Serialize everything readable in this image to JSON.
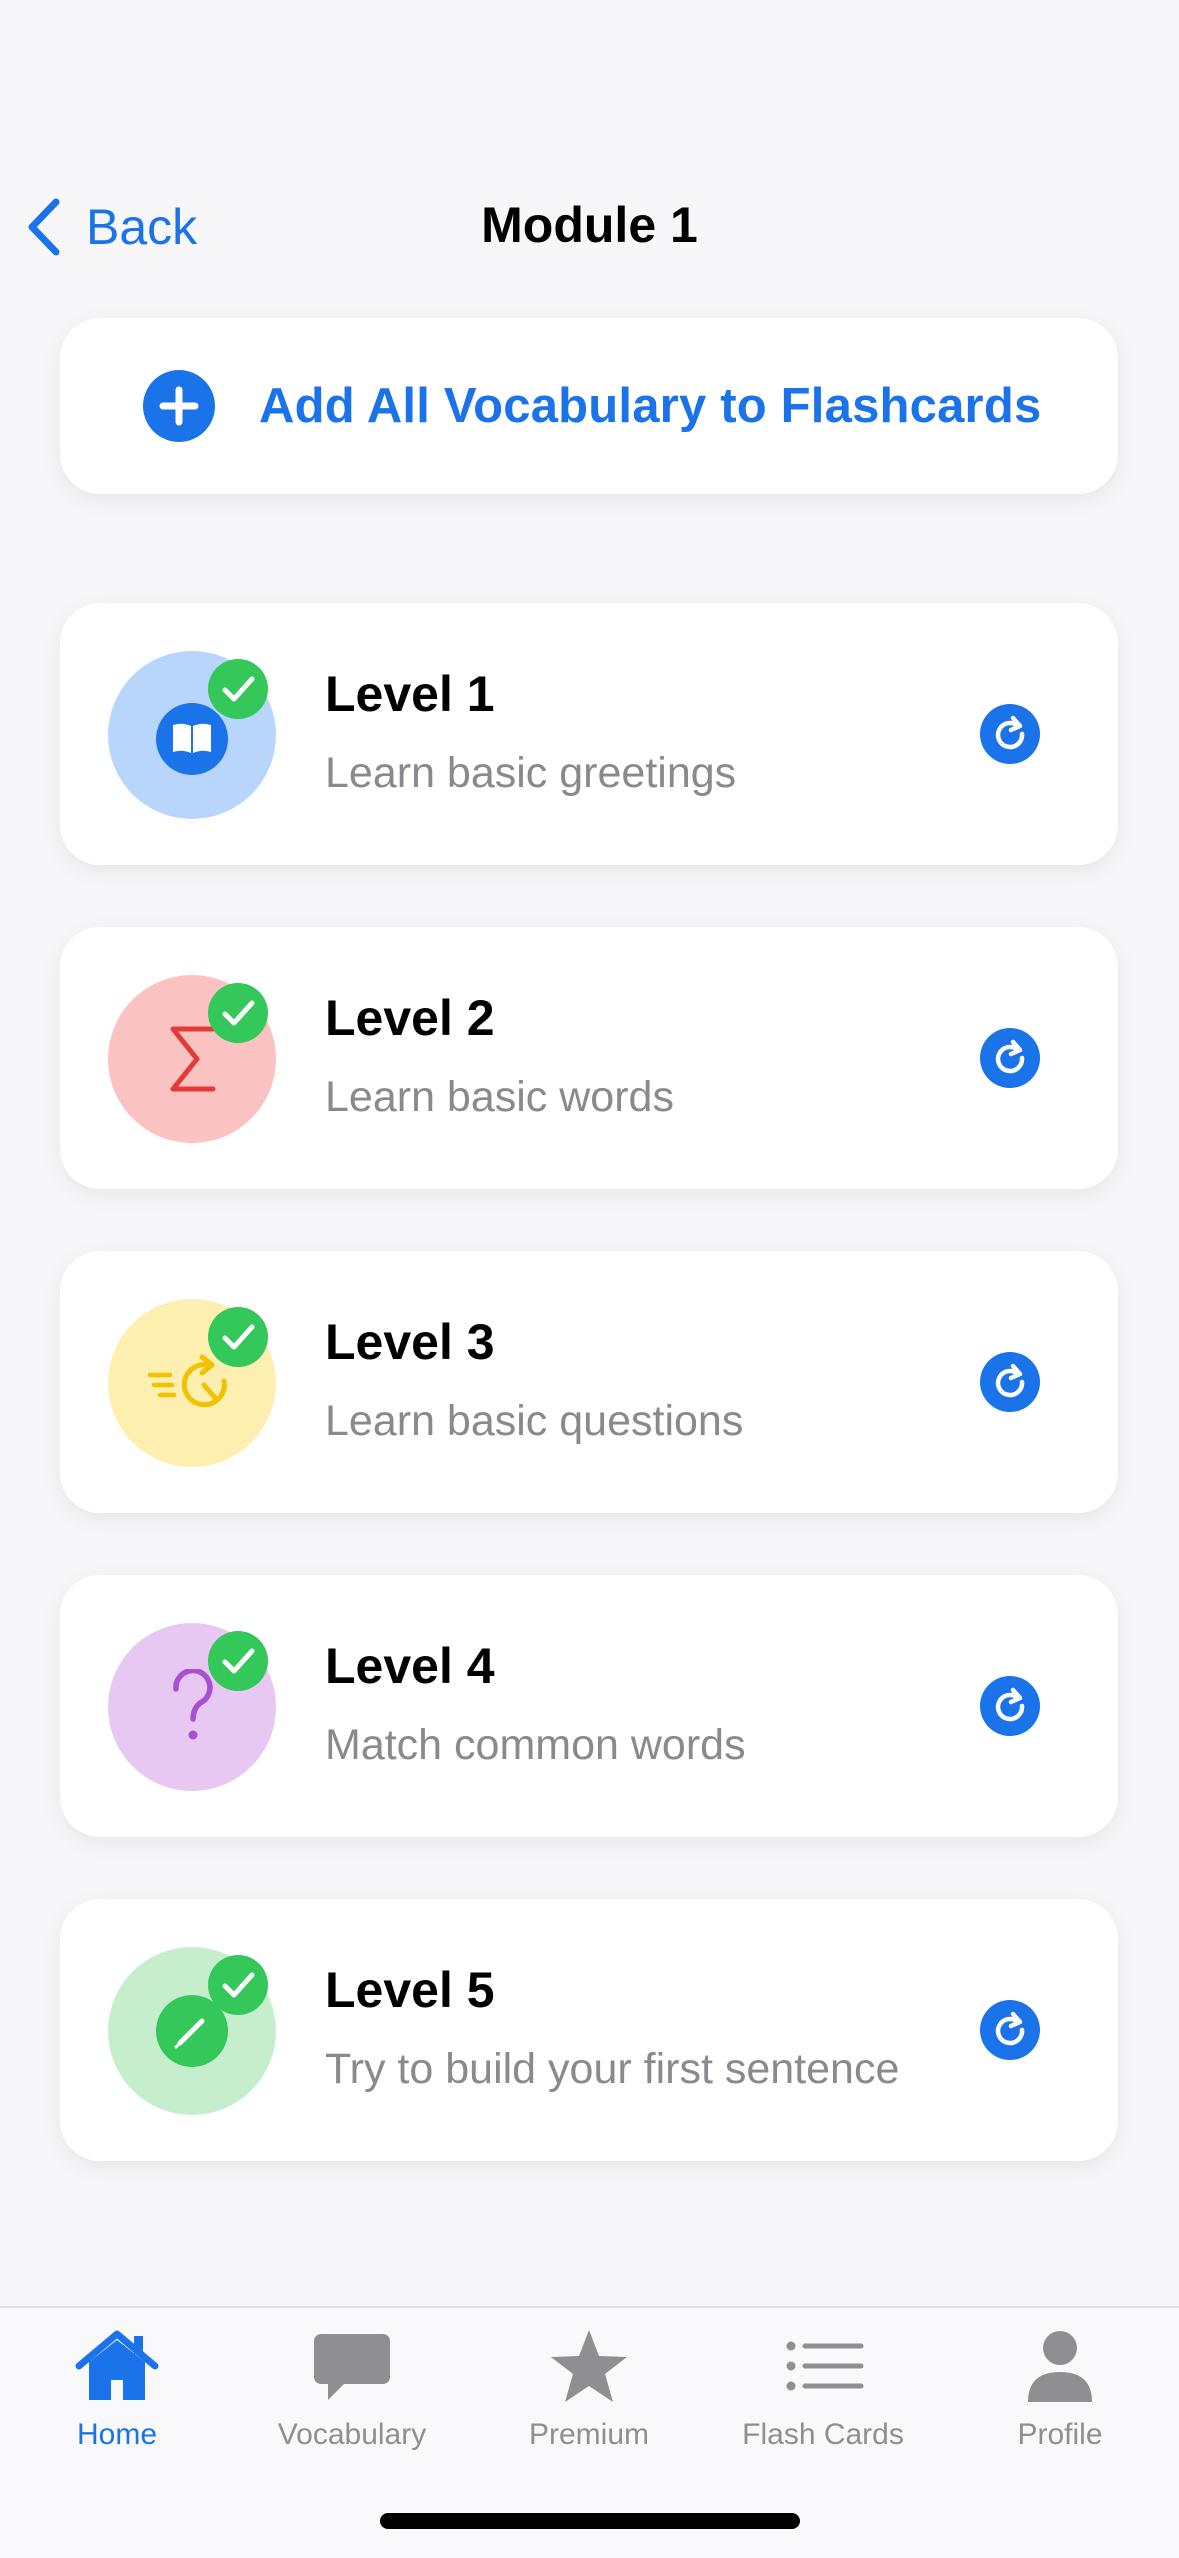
{
  "nav": {
    "back_label": "Back",
    "title": "Module 1"
  },
  "add_all": {
    "label": "Add All Vocabulary to Flashcards",
    "icon": "plus-circle-icon"
  },
  "levels": [
    {
      "title": "Level 1",
      "subtitle": "Learn basic greetings",
      "icon": "book-icon",
      "bg": "#b8d6fb",
      "color": "#1a73e8",
      "completed": true
    },
    {
      "title": "Level 2",
      "subtitle": "Learn basic words",
      "icon": "sigma-icon",
      "bg": "#fbc2c2",
      "color": "#e53935",
      "completed": true
    },
    {
      "title": "Level 3",
      "subtitle": "Learn basic questions",
      "icon": "speed-icon",
      "bg": "#fcefb0",
      "color": "#f2c200",
      "completed": true
    },
    {
      "title": "Level 4",
      "subtitle": "Match common words",
      "icon": "question-icon",
      "bg": "#e6c8f3",
      "color": "#a94fd1",
      "completed": true
    },
    {
      "title": "Level 5",
      "subtitle": "Try to build your first sentence",
      "icon": "pencil-icon",
      "bg": "#c6eecd",
      "color": "#34c759",
      "completed": true
    }
  ],
  "tabs": [
    {
      "label": "Home",
      "icon": "home-icon",
      "active": true
    },
    {
      "label": "Vocabulary",
      "icon": "chat-bubble-icon",
      "active": false
    },
    {
      "label": "Premium",
      "icon": "star-icon",
      "active": false
    },
    {
      "label": "Flash Cards",
      "icon": "list-icon",
      "active": false
    },
    {
      "label": "Profile",
      "icon": "person-icon",
      "active": false
    }
  ],
  "colors": {
    "accent": "#1a73e8",
    "success": "#34c759",
    "secondary_text": "#8a8a8e",
    "tab_inactive": "#8e8e93"
  }
}
